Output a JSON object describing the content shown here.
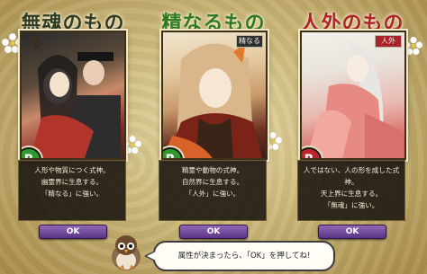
{
  "categories": [
    {
      "title": "無魂のもの",
      "title_color": "#2f3b22",
      "badge": "",
      "rank": "R",
      "rank_color": "#2f9a2a",
      "description": [
        "人形や物質につく式神。",
        "幽霊界に生息する。",
        "「精なる」に強い。"
      ],
      "ok_label": "OK"
    },
    {
      "title": "精なるもの",
      "title_color": "#2f7a1e",
      "badge": "精なる",
      "rank": "R",
      "rank_color": "#2f9a2a",
      "description": [
        "精霊や動物の式神。",
        "自然界に生息する。",
        "「人外」に強い。"
      ],
      "ok_label": "OK"
    },
    {
      "title": "人外のもの",
      "title_color": "#b0222a",
      "badge": "人外",
      "rank": "R",
      "rank_color": "#c0242a",
      "description": [
        "人ではない、人の形を成した式神。",
        "天上界に生息する。",
        "「無魂」に強い。"
      ],
      "ok_label": "OK"
    }
  ],
  "message": "属性が決まったら、「OK」を押してね!"
}
